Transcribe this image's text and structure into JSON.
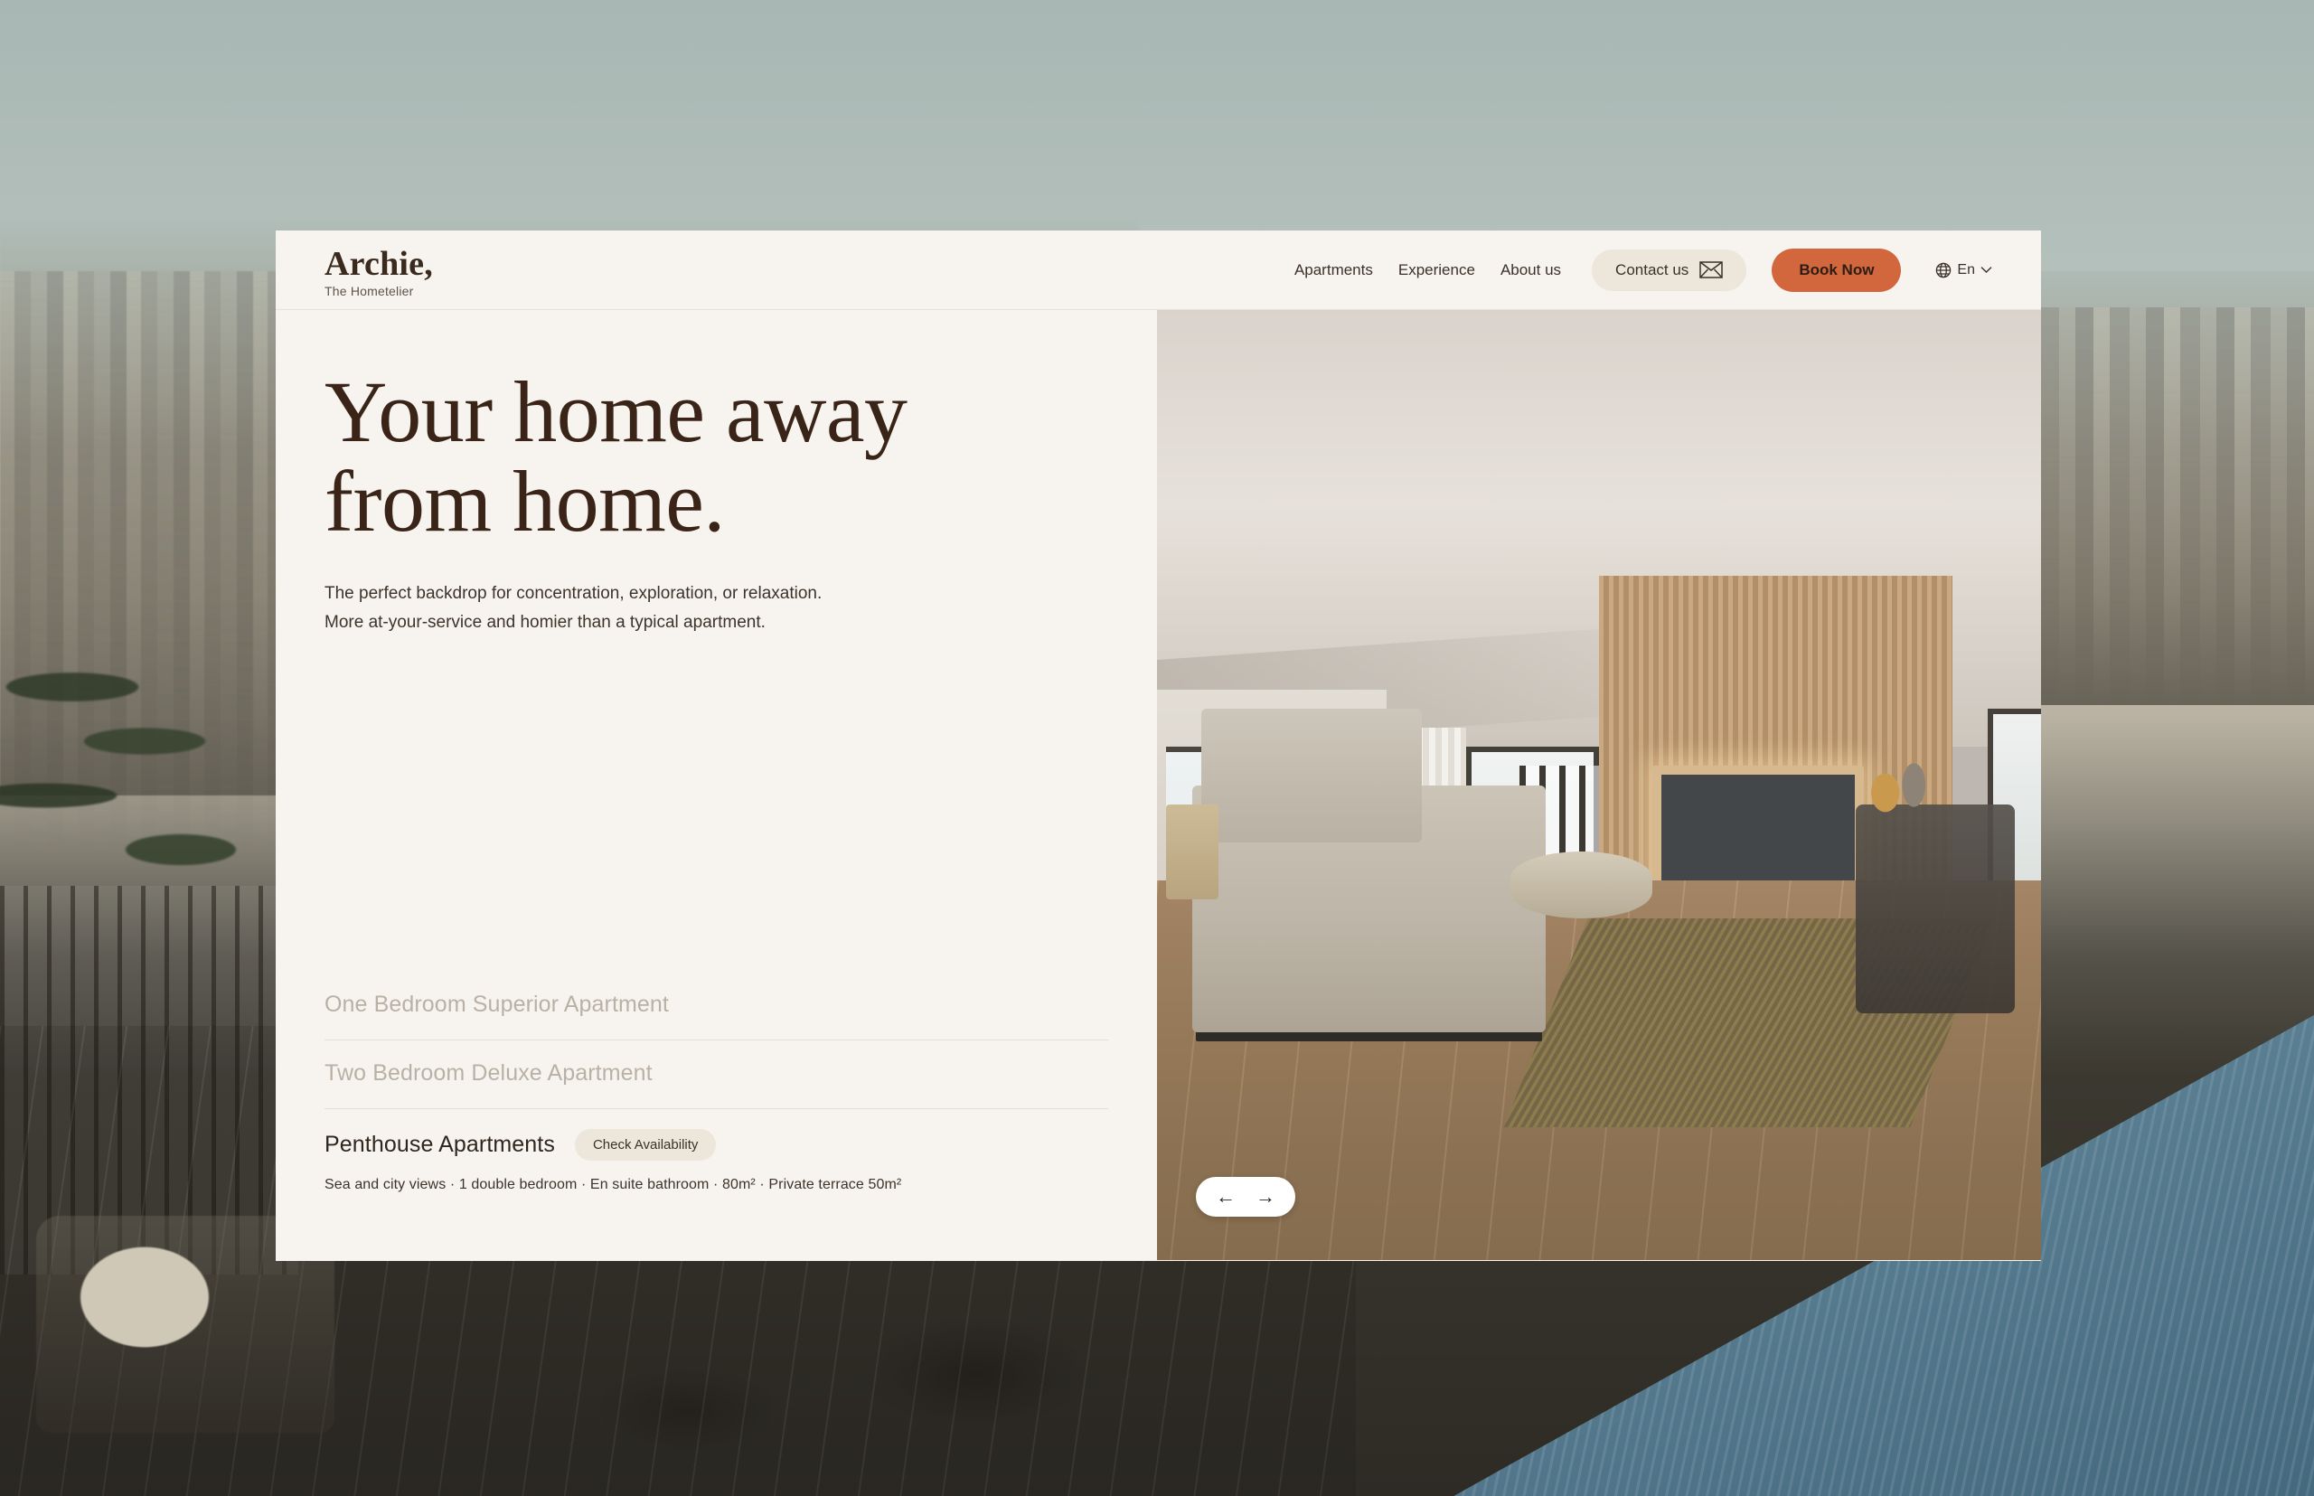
{
  "brand": {
    "name": "Archie,",
    "tagline": "The Hometelier"
  },
  "header": {
    "nav_links": [
      {
        "label": "Apartments"
      },
      {
        "label": "Experience"
      },
      {
        "label": "About us"
      }
    ],
    "contact_button": {
      "label": "Contact us",
      "icon": "envelope-icon"
    },
    "book_button": {
      "label": "Book Now",
      "color": "#d2663c"
    },
    "language": {
      "icon": "globe-icon",
      "value": "En",
      "chevron": "chevron-down-icon"
    }
  },
  "hero": {
    "headline_line_1": "Your home away",
    "headline_line_2": "from home.",
    "subtitle_line_1": "The perfect backdrop for concentration, exploration, or relaxation.",
    "subtitle_line_2": "More at-your-service and homier than a typical apartment."
  },
  "apartments": [
    {
      "title": "One Bedroom Superior Apartment",
      "active": false,
      "badge": null,
      "meta": null
    },
    {
      "title": "Two Bedroom Deluxe Apartment",
      "active": false,
      "badge": null,
      "meta": null
    },
    {
      "title": "Penthouse Apartments",
      "active": true,
      "badge": "Check Availability",
      "meta": "Sea and city views · 1 double bedroom · En suite bathroom · 80m² · Private terrace 50m²"
    }
  ],
  "carousel": {
    "prev_icon": "arrow-left-icon",
    "next_icon": "arrow-right-icon",
    "prev_glyph": "←",
    "next_glyph": "→"
  },
  "colors": {
    "panel_background": "#f7f4ef",
    "accent": "#d2663c",
    "pill_background": "#ece6db",
    "heading_text": "#3a2418",
    "muted_text": "#b9b1a6"
  }
}
